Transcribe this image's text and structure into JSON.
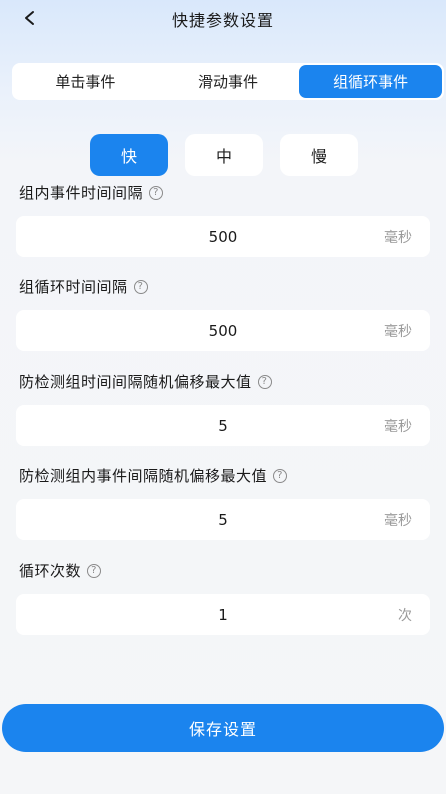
{
  "header": {
    "title": "快捷参数设置",
    "back_icon": "chevron-left-icon"
  },
  "tabs": [
    {
      "label": "单击事件",
      "active": false
    },
    {
      "label": "滑动事件",
      "active": false
    },
    {
      "label": "组循环事件",
      "active": true
    }
  ],
  "speed": {
    "options": [
      {
        "label": "快",
        "active": true
      },
      {
        "label": "中",
        "active": false
      },
      {
        "label": "慢",
        "active": false
      }
    ]
  },
  "fields": [
    {
      "label": "组内事件时间间隔",
      "value": "500",
      "unit": "毫秒"
    },
    {
      "label": "组循环时间间隔",
      "value": "500",
      "unit": "毫秒"
    },
    {
      "label": "防检测组时间间隔随机偏移最大值",
      "value": "5",
      "unit": "毫秒"
    },
    {
      "label": "防检测组内事件间隔随机偏移最大值",
      "value": "5",
      "unit": "毫秒"
    },
    {
      "label": "循环次数",
      "value": "1",
      "unit": "次"
    }
  ],
  "help_icon_glyph": "?",
  "save_label": "保存设置",
  "colors": {
    "accent": "#1b84ee",
    "unit_text": "#9a9a9a"
  }
}
